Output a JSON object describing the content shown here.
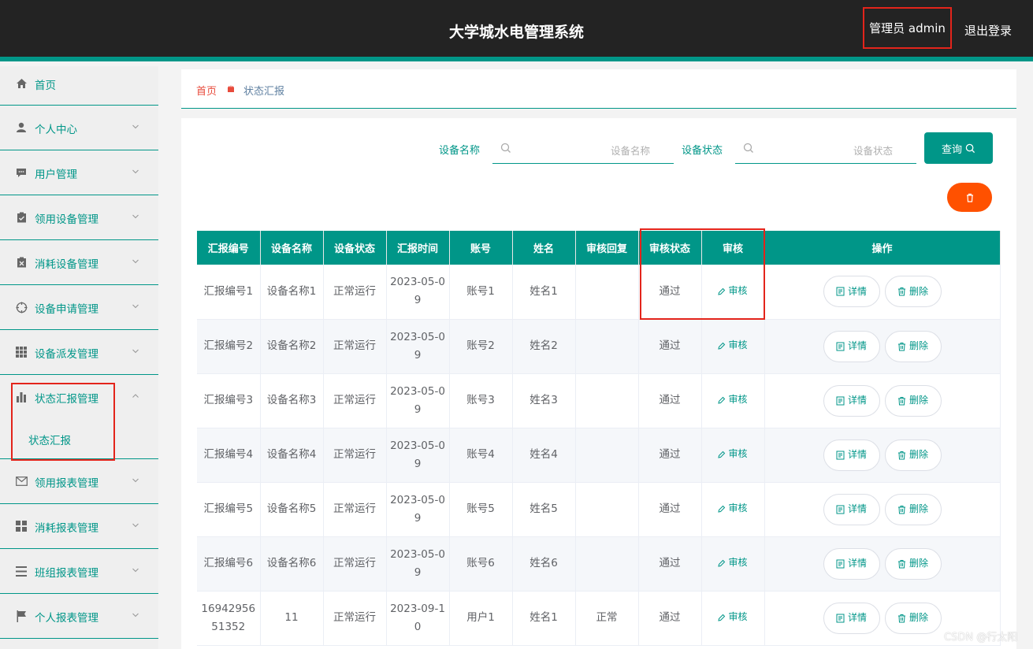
{
  "header": {
    "title": "大学城水电管理系统",
    "admin_label": "管理员 admin",
    "logout_label": "退出登录"
  },
  "sidebar": {
    "items": [
      {
        "label": "首页",
        "icon": "home-icon"
      },
      {
        "label": "个人中心",
        "icon": "user-icon"
      },
      {
        "label": "用户管理",
        "icon": "chat-icon"
      },
      {
        "label": "领用设备管理",
        "icon": "clipboard-check-icon"
      },
      {
        "label": "消耗设备管理",
        "icon": "clipboard-x-icon"
      },
      {
        "label": "设备申请管理",
        "icon": "target-icon"
      },
      {
        "label": "设备派发管理",
        "icon": "grid-icon"
      },
      {
        "label": "状态汇报管理",
        "icon": "bar-chart-icon"
      },
      {
        "label": "领用报表管理",
        "icon": "mail-icon"
      },
      {
        "label": "消耗报表管理",
        "icon": "apps-icon"
      },
      {
        "label": "班组报表管理",
        "icon": "list-icon"
      },
      {
        "label": "个人报表管理",
        "icon": "flag-icon"
      }
    ],
    "sub_item": "状态汇报"
  },
  "breadcrumb": {
    "home": "首页",
    "current": "状态汇报"
  },
  "search": {
    "name_label": "设备名称",
    "name_placeholder": "设备名称",
    "status_label": "设备状态",
    "status_placeholder": "设备状态",
    "query_label": "查询"
  },
  "table": {
    "headers": [
      "汇报编号",
      "设备名称",
      "设备状态",
      "汇报时间",
      "账号",
      "姓名",
      "审核回复",
      "审核状态",
      "审核",
      "操作"
    ],
    "audit_label": "审核",
    "detail_label": "详情",
    "delete_label": "删除",
    "rows": [
      {
        "no": "汇报编号1",
        "device": "设备名称1",
        "status": "正常运行",
        "time": "2023-05-09",
        "account": "账号1",
        "name": "姓名1",
        "reply": "",
        "audit_status": "通过"
      },
      {
        "no": "汇报编号2",
        "device": "设备名称2",
        "status": "正常运行",
        "time": "2023-05-09",
        "account": "账号2",
        "name": "姓名2",
        "reply": "",
        "audit_status": "通过"
      },
      {
        "no": "汇报编号3",
        "device": "设备名称3",
        "status": "正常运行",
        "time": "2023-05-09",
        "account": "账号3",
        "name": "姓名3",
        "reply": "",
        "audit_status": "通过"
      },
      {
        "no": "汇报编号4",
        "device": "设备名称4",
        "status": "正常运行",
        "time": "2023-05-09",
        "account": "账号4",
        "name": "姓名4",
        "reply": "",
        "audit_status": "通过"
      },
      {
        "no": "汇报编号5",
        "device": "设备名称5",
        "status": "正常运行",
        "time": "2023-05-09",
        "account": "账号5",
        "name": "姓名5",
        "reply": "",
        "audit_status": "通过"
      },
      {
        "no": "汇报编号6",
        "device": "设备名称6",
        "status": "正常运行",
        "time": "2023-05-09",
        "account": "账号6",
        "name": "姓名6",
        "reply": "",
        "audit_status": "通过"
      },
      {
        "no": "1694295651352",
        "device": "11",
        "status": "正常运行",
        "time": "2023-09-10",
        "account": "用户1",
        "name": "姓名1",
        "reply": "正常",
        "audit_status": "通过"
      }
    ]
  },
  "watermark": "CSDN @行太阳",
  "colors": {
    "accent": "#009688",
    "topbar": "#232323",
    "danger": "#ff5100",
    "highlight": "#e3241b"
  }
}
